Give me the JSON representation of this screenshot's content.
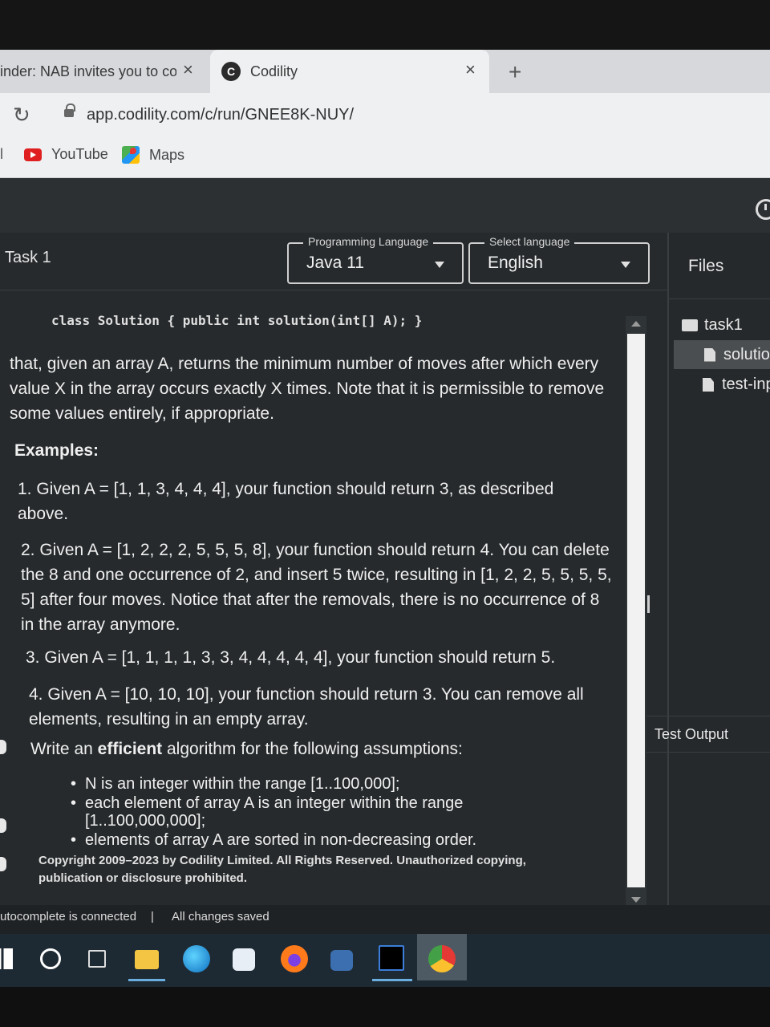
{
  "browser": {
    "tabs": [
      {
        "title": "inder: NAB invites you to co",
        "close": "×"
      },
      {
        "title": "Codility",
        "close": "×",
        "favicon": "C"
      }
    ],
    "new_tab": "+",
    "url": "app.codility.com/c/run/GNEE8K-NUY/",
    "bookmarks": [
      {
        "label": "YouTube",
        "icon": "youtube-icon"
      },
      {
        "label": "Maps",
        "icon": "maps-icon"
      }
    ],
    "bookmarks_edge": "l"
  },
  "app": {
    "task_title": "Task 1",
    "programming_language": {
      "label": "Programming Language",
      "value": "Java 11"
    },
    "select_language": {
      "label": "Select language",
      "value": "English"
    },
    "files": {
      "title": "Files",
      "folder": "task1",
      "items": [
        "solutio",
        "test-inp"
      ]
    },
    "test_output": "Test Output",
    "description": {
      "code": "class Solution { public int solution(int[] A); }",
      "intro": "that, given an array A, returns the minimum number of moves after which every value X in the array occurs exactly X times. Note that it is permissible to remove some values entirely, if appropriate.",
      "examples_heading": "Examples:",
      "examples": [
        "1. Given A = [1, 1, 3, 4, 4, 4], your function should return 3, as described above.",
        "2. Given A = [1, 2, 2, 2, 5, 5, 5, 8], your function should return 4. You can delete the 8 and one occurrence of 2, and insert 5 twice, resulting in [1, 2, 2, 5, 5, 5, 5, 5] after four moves. Notice that after the removals, there is no occurrence of 8 in the array anymore.",
        "3. Given A = [1, 1, 1, 1, 3, 3, 4, 4, 4, 4, 4], your function should return 5.",
        "4. Given A = [10, 10, 10], your function should return 3. You can remove all elements, resulting in an empty array."
      ],
      "assumptions_pre": "Write an ",
      "assumptions_bold": "efficient",
      "assumptions_post": " algorithm for the following assumptions:",
      "assumptions": [
        "N is an integer within the range [1..100,000];",
        "each element of array A is an integer within the range [1..100,000,000];",
        "elements of array A are sorted in non-decreasing order."
      ],
      "copyright": "Copyright 2009–2023 by Codility Limited. All Rights Reserved. Unauthorized copying, publication or disclosure prohibited."
    },
    "status": {
      "autocomplete": "utocomplete is connected",
      "separator": "|",
      "saved": "All changes saved"
    }
  },
  "taskbar": {
    "icons": [
      "windows-start-icon",
      "search-icon",
      "task-view-icon",
      "file-explorer-icon",
      "edge-icon",
      "store-icon",
      "firefox-icon",
      "media-player-icon",
      "intellij-icon",
      "chrome-icon"
    ]
  }
}
